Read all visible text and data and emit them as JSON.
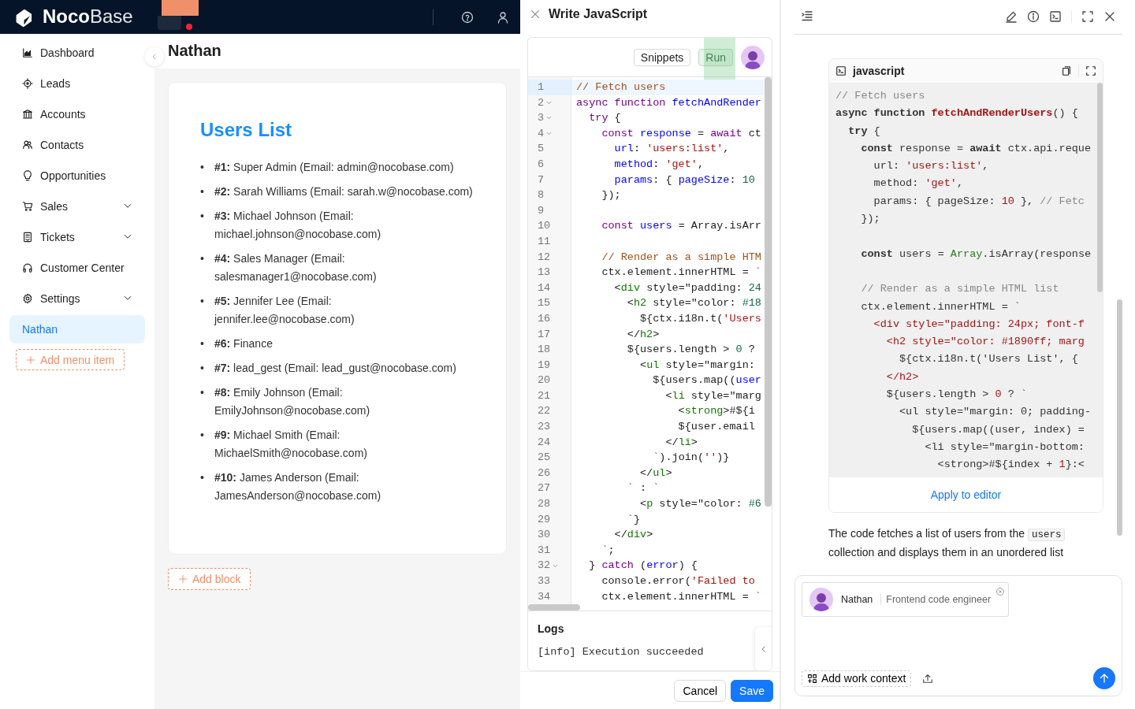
{
  "header": {
    "logo": "**Noco**Base"
  },
  "sidebar": {
    "items": [
      {
        "label": "Dashboard",
        "kind": "link",
        "selected": false
      },
      {
        "label": "Leads",
        "kind": "link",
        "selected": false
      },
      {
        "label": "Accounts",
        "kind": "link",
        "selected": false
      },
      {
        "label": "Contacts",
        "kind": "link",
        "selected": false
      },
      {
        "label": "Opportunities",
        "kind": "link",
        "selected": false
      },
      {
        "label": "Sales",
        "kind": "group",
        "selected": false
      },
      {
        "label": "Tickets",
        "kind": "group",
        "selected": false
      },
      {
        "label": "Customer Center",
        "kind": "link",
        "selected": false
      },
      {
        "label": "Settings",
        "kind": "group",
        "selected": false
      },
      {
        "label": "Nathan",
        "kind": "link",
        "selected": true
      }
    ],
    "add_button": "Add menu item"
  },
  "page": {
    "title": "Nathan",
    "card": {
      "heading": "Users List",
      "items": [
        {
          "bullet": "•",
          "text": "**#1:** Super Admin (Email: admin@nocobase.com)"
        },
        {
          "bullet": "•",
          "text": "**#2:** Sarah Williams (Email: sarah.w@nocobase.com)"
        },
        {
          "bullet": "•",
          "text": "**#3:** Michael Johnson (Email: michael.johnson@nocobase.com)"
        },
        {
          "bullet": "•",
          "text": "**#4:** Sales Manager (Email: salesmanager1@nocobase.com)"
        },
        {
          "bullet": "•",
          "text": "**#5:** Jennifer Lee (Email: jennifer.lee@nocobase.com)"
        },
        {
          "bullet": "•",
          "text": "**#6:** Finance"
        },
        {
          "bullet": "•",
          "text": "**#7:** lead_gest (Email: lead_gust@nocobase.com)"
        },
        {
          "bullet": "•",
          "text": "**#8:** Emily Johnson (Email: EmilyJohnson@nocobase.com)"
        },
        {
          "bullet": "•",
          "text": "**#9:** Michael Smith (Email: MichaelSmith@nocobase.com)"
        },
        {
          "bullet": "•",
          "text": "**#10:** James Anderson (Email: JamesAnderson@nocobase.com)"
        }
      ]
    },
    "add_block": "Add block"
  },
  "drawer": {
    "title": "Write JavaScript",
    "snippets": "Snippets",
    "run": "Run",
    "lines": [
      {
        "n": "1",
        "fold": false,
        "active": true,
        "tokens": [
          {
            "text": "// Fetch users",
            "kind": "comment"
          }
        ]
      },
      {
        "n": "2",
        "fold": true,
        "active": false,
        "tokens": [
          {
            "text": "async function",
            "kind": "kw"
          },
          {
            "text": " fetchAndRender",
            "kind": "def"
          }
        ]
      },
      {
        "n": "3",
        "fold": true,
        "active": false,
        "tokens": [
          {
            "text": "  try",
            "kind": "kw"
          },
          {
            "text": " {",
            "kind": "plain"
          }
        ]
      },
      {
        "n": "4",
        "fold": true,
        "active": false,
        "tokens": [
          {
            "text": "    const",
            "kind": "kw"
          },
          {
            "text": " response",
            "kind": "def"
          },
          {
            "text": " = ",
            "kind": "plain"
          },
          {
            "text": "await",
            "kind": "kw"
          },
          {
            "text": " ct",
            "kind": "plain"
          }
        ]
      },
      {
        "n": "5",
        "fold": false,
        "active": false,
        "tokens": [
          {
            "text": "      url",
            "kind": "def"
          },
          {
            "text": ": ",
            "kind": "plain"
          },
          {
            "text": "'users:list'",
            "kind": "string"
          },
          {
            "text": ",",
            "kind": "plain"
          }
        ]
      },
      {
        "n": "6",
        "fold": false,
        "active": false,
        "tokens": [
          {
            "text": "      method",
            "kind": "def"
          },
          {
            "text": ": ",
            "kind": "plain"
          },
          {
            "text": "'get'",
            "kind": "string"
          },
          {
            "text": ",",
            "kind": "plain"
          }
        ]
      },
      {
        "n": "7",
        "fold": false,
        "active": false,
        "tokens": [
          {
            "text": "      params",
            "kind": "def"
          },
          {
            "text": ": { ",
            "kind": "plain"
          },
          {
            "text": "pageSize",
            "kind": "def"
          },
          {
            "text": ": ",
            "kind": "plain"
          },
          {
            "text": "10",
            "kind": "number"
          }
        ]
      },
      {
        "n": "8",
        "fold": false,
        "active": false,
        "tokens": [
          {
            "text": "    });",
            "kind": "plain"
          }
        ]
      },
      {
        "n": "9",
        "fold": false,
        "active": false
      },
      {
        "n": "10",
        "fold": false,
        "active": false,
        "tokens": [
          {
            "text": "    const",
            "kind": "kw"
          },
          {
            "text": " users",
            "kind": "def"
          },
          {
            "text": " = Array.isArr",
            "kind": "plain"
          }
        ]
      },
      {
        "n": "11",
        "fold": false,
        "active": false
      },
      {
        "n": "12",
        "fold": false,
        "active": false,
        "tokens": [
          {
            "text": "    // Render as a simple HTM",
            "kind": "comment"
          }
        ]
      },
      {
        "n": "13",
        "fold": false,
        "active": false,
        "tokens": [
          {
            "text": "    ctx.element.innerHTML = ",
            "kind": "plain"
          },
          {
            "text": "`",
            "kind": "string"
          }
        ]
      },
      {
        "n": "14",
        "fold": false,
        "active": false,
        "tokens": [
          {
            "text": "      <",
            "kind": "plain"
          },
          {
            "text": "div",
            "kind": "tag"
          },
          {
            "text": " style=\"padding: ",
            "kind": "plain"
          },
          {
            "text": "24",
            "kind": "number"
          }
        ]
      },
      {
        "n": "15",
        "fold": false,
        "active": false,
        "tokens": [
          {
            "text": "        <",
            "kind": "plain"
          },
          {
            "text": "h2",
            "kind": "tag"
          },
          {
            "text": " style=\"color: ",
            "kind": "plain"
          },
          {
            "text": "#18",
            "kind": "number"
          }
        ]
      },
      {
        "n": "16",
        "fold": false,
        "active": false,
        "tokens": [
          {
            "text": "          ${ctx.i18n.t(",
            "kind": "plain"
          },
          {
            "text": "'Users",
            "kind": "string"
          }
        ]
      },
      {
        "n": "17",
        "fold": false,
        "active": false,
        "tokens": [
          {
            "text": "        </",
            "kind": "plain"
          },
          {
            "text": "h2",
            "kind": "tag"
          },
          {
            "text": ">",
            "kind": "plain"
          }
        ]
      },
      {
        "n": "18",
        "fold": false,
        "active": false,
        "tokens": [
          {
            "text": "        ${users.length > ",
            "kind": "plain"
          },
          {
            "text": "0",
            "kind": "number"
          },
          {
            "text": " ?",
            "kind": "plain"
          }
        ]
      },
      {
        "n": "19",
        "fold": false,
        "active": false,
        "tokens": [
          {
            "text": "          <",
            "kind": "plain"
          },
          {
            "text": "ul",
            "kind": "tag"
          },
          {
            "text": " style=\"margin:",
            "kind": "plain"
          }
        ]
      },
      {
        "n": "20",
        "fold": false,
        "active": false,
        "tokens": [
          {
            "text": "            ${users.map((",
            "kind": "plain"
          },
          {
            "text": "user",
            "kind": "def"
          }
        ]
      },
      {
        "n": "21",
        "fold": false,
        "active": false,
        "tokens": [
          {
            "text": "              <",
            "kind": "plain"
          },
          {
            "text": "li",
            "kind": "tag"
          },
          {
            "text": " style=\"marg",
            "kind": "plain"
          }
        ]
      },
      {
        "n": "22",
        "fold": false,
        "active": false,
        "tokens": [
          {
            "text": "                <",
            "kind": "plain"
          },
          {
            "text": "strong",
            "kind": "tag"
          },
          {
            "text": ">#${i",
            "kind": "plain"
          }
        ]
      },
      {
        "n": "23",
        "fold": false,
        "active": false,
        "tokens": [
          {
            "text": "                ${user.email",
            "kind": "plain"
          }
        ]
      },
      {
        "n": "24",
        "fold": false,
        "active": false,
        "tokens": [
          {
            "text": "              </",
            "kind": "plain"
          },
          {
            "text": "li",
            "kind": "tag"
          },
          {
            "text": ">",
            "kind": "plain"
          }
        ]
      },
      {
        "n": "25",
        "fold": false,
        "active": false,
        "tokens": [
          {
            "text": "            `",
            "kind": "string"
          },
          {
            "text": ").join(",
            "kind": "plain"
          },
          {
            "text": "''",
            "kind": "string"
          },
          {
            "text": ")}",
            "kind": "plain"
          }
        ]
      },
      {
        "n": "26",
        "fold": false,
        "active": false,
        "tokens": [
          {
            "text": "          </",
            "kind": "plain"
          },
          {
            "text": "ul",
            "kind": "tag"
          },
          {
            "text": ">",
            "kind": "plain"
          }
        ]
      },
      {
        "n": "27",
        "fold": false,
        "active": false,
        "tokens": [
          {
            "text": "        `",
            "kind": "string"
          },
          {
            "text": " : ",
            "kind": "plain"
          },
          {
            "text": "`",
            "kind": "string"
          }
        ]
      },
      {
        "n": "28",
        "fold": false,
        "active": false,
        "tokens": [
          {
            "text": "          <",
            "kind": "plain"
          },
          {
            "text": "p",
            "kind": "tag"
          },
          {
            "text": " style=\"color: ",
            "kind": "plain"
          },
          {
            "text": "#6",
            "kind": "number"
          }
        ]
      },
      {
        "n": "29",
        "fold": false,
        "active": false,
        "tokens": [
          {
            "text": "        `",
            "kind": "string"
          },
          {
            "text": "}",
            "kind": "plain"
          }
        ]
      },
      {
        "n": "30",
        "fold": false,
        "active": false,
        "tokens": [
          {
            "text": "      </",
            "kind": "plain"
          },
          {
            "text": "div",
            "kind": "tag"
          },
          {
            "text": ">",
            "kind": "plain"
          }
        ]
      },
      {
        "n": "31",
        "fold": false,
        "active": false,
        "tokens": [
          {
            "text": "    `",
            "kind": "string"
          },
          {
            "text": ";",
            "kind": "plain"
          }
        ]
      },
      {
        "n": "32",
        "fold": true,
        "active": false,
        "tokens": [
          {
            "text": "  } ",
            "kind": "plain"
          },
          {
            "text": "catch",
            "kind": "kw"
          },
          {
            "text": " (",
            "kind": "plain"
          },
          {
            "text": "error",
            "kind": "def"
          },
          {
            "text": ") {",
            "kind": "plain"
          }
        ]
      },
      {
        "n": "33",
        "fold": false,
        "active": false,
        "tokens": [
          {
            "text": "    console.error(",
            "kind": "plain"
          },
          {
            "text": "'Failed to",
            "kind": "string"
          }
        ]
      },
      {
        "n": "34",
        "fold": false,
        "active": false,
        "tokens": [
          {
            "text": "    ctx.element.innerHTML = ",
            "kind": "plain"
          },
          {
            "text": "`",
            "kind": "string"
          }
        ]
      }
    ],
    "logs_title": "Logs",
    "logs": [
      "[info] Execution succeeded"
    ],
    "cancel": "Cancel",
    "save": "Save"
  },
  "assistant": {
    "language": "javascript",
    "blocks": [
      {
        "lines": [
          {
            "tokens": [
              {
                "text": "// Fetch users",
                "kind": "comment"
              }
            ]
          },
          {
            "tokens": [
              {
                "text": "async function",
                "kind": "kw"
              },
              {
                "text": " fetchAndRenderUsers",
                "kind": "def"
              },
              {
                "text": "() {",
                "kind": "plain"
              }
            ]
          },
          {
            "tokens": [
              {
                "text": "  try",
                "kind": "kw"
              },
              {
                "text": " {",
                "kind": "plain"
              }
            ]
          },
          {
            "tokens": [
              {
                "text": "    const",
                "kind": "kw"
              },
              {
                "text": " response = ",
                "kind": "plain"
              },
              {
                "text": "await",
                "kind": "kw"
              },
              {
                "text": " ctx.api.reque",
                "kind": "plain"
              }
            ]
          },
          {
            "tokens": [
              {
                "text": "      url: ",
                "kind": "plain"
              },
              {
                "text": "'users:list'",
                "kind": "string"
              },
              {
                "text": ",",
                "kind": "plain"
              }
            ]
          },
          {
            "tokens": [
              {
                "text": "      method: ",
                "kind": "plain"
              },
              {
                "text": "'get'",
                "kind": "string"
              },
              {
                "text": ",",
                "kind": "plain"
              }
            ]
          },
          {
            "tokens": [
              {
                "text": "      params: { pageSize: ",
                "kind": "plain"
              },
              {
                "text": "10",
                "kind": "number"
              },
              {
                "text": " }, ",
                "kind": "plain"
              },
              {
                "text": "// Fetc",
                "kind": "comment"
              }
            ]
          },
          {
            "tokens": [
              {
                "text": "    });",
                "kind": "plain"
              }
            ]
          }
        ]
      },
      {
        "lines": [
          {
            "tokens": [
              {
                "text": "    const",
                "kind": "kw"
              },
              {
                "text": " users = ",
                "kind": "plain"
              },
              {
                "text": "Array",
                "kind": "builtin"
              },
              {
                "text": ".isArray(response",
                "kind": "plain"
              }
            ]
          }
        ]
      },
      {
        "lines": [
          {
            "tokens": [
              {
                "text": "    // Render as a simple HTML list",
                "kind": "comment"
              }
            ]
          },
          {
            "tokens": [
              {
                "text": "    ctx.element.innerHTML = `",
                "kind": "plain"
              }
            ]
          },
          {
            "tokens": [
              {
                "text": "      <div style=\"padding: 24px; font-f",
                "kind": "string"
              }
            ]
          },
          {
            "tokens": [
              {
                "text": "        <h2 style=\"color: #1890ff; marg",
                "kind": "string"
              }
            ]
          },
          {
            "tokens": [
              {
                "text": "          ${ctx.i18n.t('Users List', {",
                "kind": "plain"
              }
            ]
          },
          {
            "tokens": [
              {
                "text": "        </h2>",
                "kind": "string"
              }
            ]
          },
          {
            "tokens": [
              {
                "text": "        ${users.length > ",
                "kind": "plain"
              },
              {
                "text": "0",
                "kind": "number"
              },
              {
                "text": " ? `",
                "kind": "plain"
              }
            ]
          },
          {
            "tokens": [
              {
                "text": "          <ul style=\"margin: 0; padding-",
                "kind": "plain"
              }
            ]
          },
          {
            "tokens": [
              {
                "text": "            ${users.map((user, index) =",
                "kind": "plain"
              }
            ]
          },
          {
            "tokens": [
              {
                "text": "              <li style=\"margin-bottom:",
                "kind": "plain"
              }
            ]
          },
          {
            "tokens": [
              {
                "text": "                <strong>#${index + ",
                "kind": "plain"
              },
              {
                "text": "1",
                "kind": "number"
              },
              {
                "text": "}:<",
                "kind": "plain"
              }
            ]
          }
        ]
      }
    ],
    "apply": "Apply to editor",
    "message": {
      "before": "The code fetches a list of users from the",
      "code": "users",
      "after": "collection and displays them in an unordered list"
    },
    "agent": {
      "name": "Nathan",
      "role": "Frontend code engineer"
    },
    "add_context": "Add work context"
  }
}
